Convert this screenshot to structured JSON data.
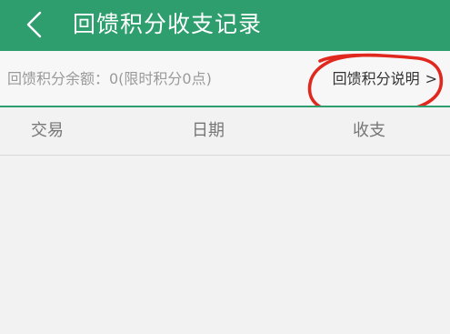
{
  "header": {
    "title": "回馈积分收支记录",
    "back_icon": "chevron-left-icon"
  },
  "balance": {
    "text": "回馈积分余额：0(限时积分0点)",
    "info_link_label": "回馈积分说明",
    "info_link_arrow": ">"
  },
  "table": {
    "columns": [
      "交易",
      "日期",
      "收支"
    ],
    "rows": []
  },
  "colors": {
    "header_bg": "#2e9e6e",
    "accent": "#2e9e6e",
    "annotation": "#e0281e"
  }
}
